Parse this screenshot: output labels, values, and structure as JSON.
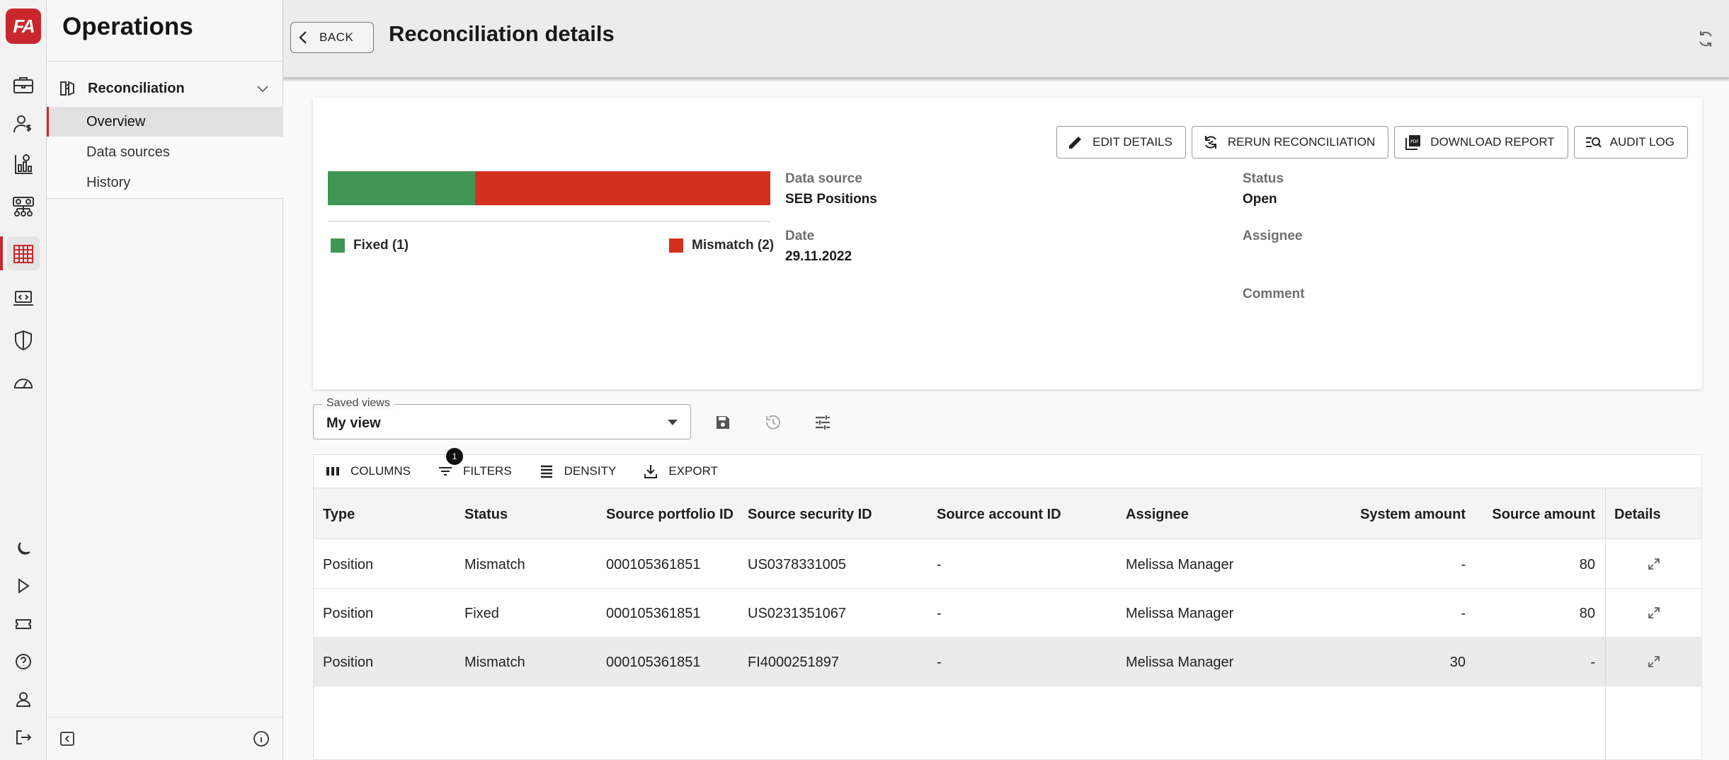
{
  "app": {
    "logo_text": "FA",
    "accent": "#c8282c"
  },
  "rail": {
    "top_icons": [
      "briefcase-icon",
      "person-money-icon",
      "chart-report-icon",
      "org-network-icon",
      "building-icon",
      "laptop-code-icon",
      "shield-icon",
      "gauge-icon"
    ],
    "bottom_icons": [
      "moon-icon",
      "play-icon",
      "ticket-icon",
      "help-icon",
      "user-icon",
      "logout-icon"
    ],
    "active": "building-icon"
  },
  "sidebar": {
    "title": "Operations",
    "group": {
      "label": "Reconciliation"
    },
    "items": [
      {
        "label": "Overview",
        "active": true
      },
      {
        "label": "Data sources",
        "active": false
      },
      {
        "label": "History",
        "active": false
      }
    ]
  },
  "header": {
    "back_label": "BACK",
    "title": "Reconciliation details"
  },
  "summary": {
    "actions": [
      "EDIT DETAILS",
      "RERUN RECONCILIATION",
      "DOWNLOAD REPORT",
      "AUDIT LOG"
    ],
    "bar": [
      {
        "label": "Fixed (1)",
        "count": 1,
        "color": "#3f9655"
      },
      {
        "label": "Mismatch (2)",
        "count": 2,
        "color": "#d3301f"
      }
    ],
    "fields": {
      "data_source_label": "Data source",
      "data_source_value": "SEB Positions",
      "date_label": "Date",
      "date_value": "29.11.2022",
      "status_label": "Status",
      "status_value": "Open",
      "assignee_label": "Assignee",
      "comment_label": "Comment"
    }
  },
  "views": {
    "label": "Saved views",
    "value": "My view"
  },
  "grid": {
    "toolbar": {
      "columns": "COLUMNS",
      "filters": "FILTERS",
      "filters_badge": "1",
      "density": "DENSITY",
      "export": "EXPORT"
    },
    "columns": [
      "Type",
      "Status",
      "Source portfolio ID",
      "Source security ID",
      "Source account ID",
      "Assignee",
      "System amount",
      "Source amount",
      "Details"
    ],
    "rows": [
      {
        "type": "Position",
        "status": "Mismatch",
        "portfolio": "000105361851",
        "security": "US0378331005",
        "account": "-",
        "assignee": "Melissa Manager",
        "system_amount": "-",
        "source_amount": "80"
      },
      {
        "type": "Position",
        "status": "Fixed",
        "portfolio": "000105361851",
        "security": "US0231351067",
        "account": "-",
        "assignee": "Melissa Manager",
        "system_amount": "-",
        "source_amount": "80"
      },
      {
        "type": "Position",
        "status": "Mismatch",
        "portfolio": "000105361851",
        "security": "FI4000251897",
        "account": "-",
        "assignee": "Melissa Manager",
        "system_amount": "30",
        "source_amount": "-"
      }
    ]
  }
}
